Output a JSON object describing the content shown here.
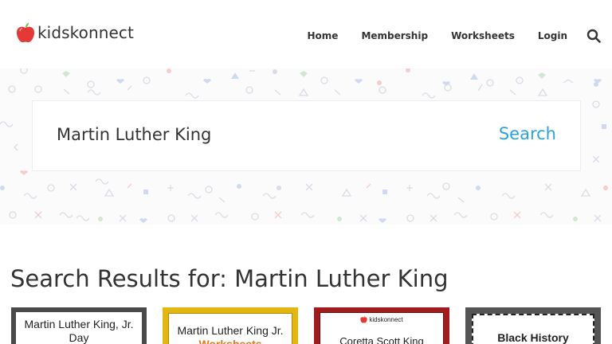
{
  "brand": {
    "name": "kidskonnect"
  },
  "nav": {
    "items": [
      {
        "label": "Home"
      },
      {
        "label": "Membership"
      },
      {
        "label": "Worksheets"
      },
      {
        "label": "Login"
      }
    ],
    "search_icon": "search-icon"
  },
  "search": {
    "value": "Martin Luther King",
    "button_label": "Search"
  },
  "results": {
    "title": "Search Results for: Martin Luther King",
    "cards": [
      {
        "lines": [
          "Martin Luther King, Jr.",
          "Day"
        ]
      },
      {
        "lines": [
          "Martin Luther King Jr.",
          "Worksheets"
        ]
      },
      {
        "brand": "kidskonnect",
        "lines": [
          "Coretta Scott King"
        ]
      },
      {
        "lines": [
          "Black History"
        ]
      }
    ]
  },
  "colors": {
    "accent": "#29a3df",
    "logo_red": "#e53935",
    "logo_leaf": "#6abf4b",
    "card2_frame": "#e2b712",
    "card2_accent": "#e0791b",
    "card3_frame": "#a11d1d"
  }
}
